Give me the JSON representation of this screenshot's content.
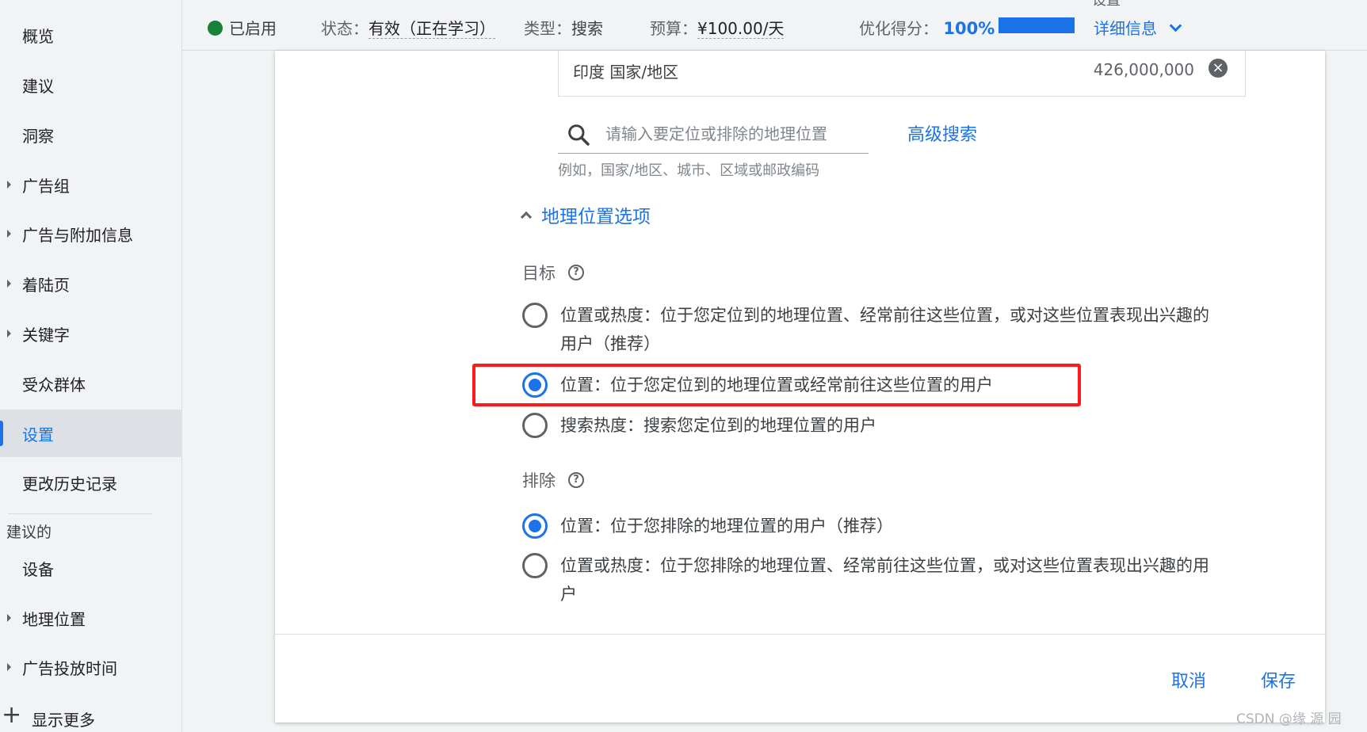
{
  "sidebar": {
    "items": [
      {
        "label": "概览",
        "expandable": false
      },
      {
        "label": "建议",
        "expandable": false
      },
      {
        "label": "洞察",
        "expandable": false
      },
      {
        "label": "广告组",
        "expandable": true
      },
      {
        "label": "广告与附加信息",
        "expandable": true
      },
      {
        "label": "着陆页",
        "expandable": true
      },
      {
        "label": "关键字",
        "expandable": true
      },
      {
        "label": "受众群体",
        "expandable": false
      },
      {
        "label": "设置",
        "expandable": false,
        "active": true
      },
      {
        "label": "更改历史记录",
        "expandable": false
      }
    ],
    "section_title": "建议的",
    "section_items": [
      {
        "label": "设备",
        "expandable": false
      },
      {
        "label": "地理位置",
        "expandable": true
      },
      {
        "label": "广告投放时间",
        "expandable": true
      }
    ],
    "show_more_label": "显示更多"
  },
  "header": {
    "overlay_title": "设置",
    "status_label": "已启用",
    "status_color": "#188038",
    "state_key": "状态：",
    "state_value": "有效（正在学习）",
    "type_key": "类型：",
    "type_value": "搜索",
    "budget_key": "预算：",
    "budget_value": "¥100.00/天",
    "score_key": "优化得分：",
    "score_value": "100%",
    "score_fraction": 1.0,
    "details_label": "详细信息"
  },
  "locations": {
    "targeted": {
      "name": "印度 国家/地区",
      "reach": "426,000,000"
    },
    "search": {
      "placeholder": "请输入要定位或排除的地理位置",
      "hint": "例如，国家/地区、城市、区域或邮政编码"
    },
    "advanced_search_label": "高级搜索"
  },
  "geo_options": {
    "toggle_label": "地理位置选项",
    "target_label": "目标",
    "target_options": [
      {
        "label": "位置或热度：位于您定位到的地理位置、经常前往这些位置，或对这些位置表现出兴趣的用户（推荐）",
        "checked": false
      },
      {
        "label": "位置：位于您定位到的地理位置或经常前往这些位置的用户",
        "checked": true
      },
      {
        "label": "搜索热度：搜索您定位到的地理位置的用户",
        "checked": false
      }
    ],
    "exclude_label": "排除",
    "exclude_options": [
      {
        "label": "位置：位于您排除的地理位置的用户（推荐）",
        "checked": true
      },
      {
        "label": "位置或热度：位于您排除的地理位置、经常前往这些位置，或对这些位置表现出兴趣的用户",
        "checked": false
      }
    ]
  },
  "footer": {
    "cancel_label": "取消",
    "save_label": "保存"
  },
  "watermark": "CSDN @缘 源 园",
  "colors": {
    "accent": "#1a73e8",
    "highlight": "#ff1a1a"
  }
}
